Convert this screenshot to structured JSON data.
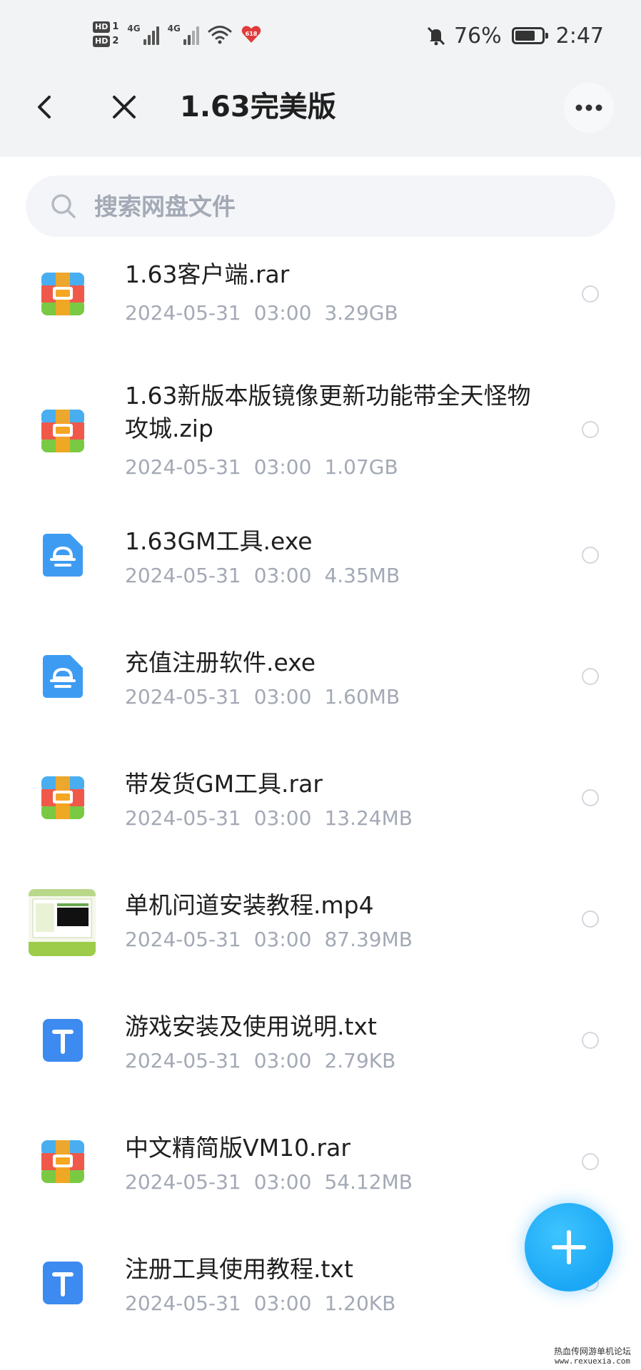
{
  "status_bar": {
    "hd1": "HD",
    "hd1_sim": "1",
    "hd2": "HD",
    "hd2_sim": "2",
    "net1": "4G",
    "net2": "4G",
    "heart_badge": "618",
    "battery_percent": "76%",
    "battery_level": 0.76,
    "time": "2:47"
  },
  "header": {
    "title": "1.63完美版"
  },
  "search": {
    "placeholder": "搜索网盘文件"
  },
  "files": [
    {
      "name": "1.63客户端.rar",
      "date": "2024-05-31",
      "time": "03:00",
      "size": "3.29GB",
      "icon": "archive-icon"
    },
    {
      "name": "1.63新版本版镜像更新功能带全天怪物攻城.zip",
      "date": "2024-05-31",
      "time": "03:00",
      "size": "1.07GB",
      "icon": "archive-icon"
    },
    {
      "name": "1.63GM工具.exe",
      "date": "2024-05-31",
      "time": "03:00",
      "size": "4.35MB",
      "icon": "executable-icon"
    },
    {
      "name": "充值注册软件.exe",
      "date": "2024-05-31",
      "time": "03:00",
      "size": "1.60MB",
      "icon": "executable-icon"
    },
    {
      "name": "带发货GM工具.rar",
      "date": "2024-05-31",
      "time": "03:00",
      "size": "13.24MB",
      "icon": "archive-icon"
    },
    {
      "name": "单机问道安装教程.mp4",
      "date": "2024-05-31",
      "time": "03:00",
      "size": "87.39MB",
      "icon": "video-thumbnail"
    },
    {
      "name": "游戏安装及使用说明.txt",
      "date": "2024-05-31",
      "time": "03:00",
      "size": "2.79KB",
      "icon": "text-file-icon"
    },
    {
      "name": "中文精简版VM10.rar",
      "date": "2024-05-31",
      "time": "03:00",
      "size": "54.12MB",
      "icon": "archive-icon"
    },
    {
      "name": "注册工具使用教程.txt",
      "date": "2024-05-31",
      "time": "03:00",
      "size": "1.20KB",
      "icon": "text-file-icon"
    }
  ],
  "watermark": {
    "line1": "热血传网游单机论坛",
    "line2": "www.rexuexia.com"
  },
  "colors": {
    "header_bg": "#f2f3f5",
    "meta_text": "#a3a9b5",
    "fab": "#1ba7f5",
    "archive_top": "#49aef0",
    "archive_mid": "#f0594a",
    "archive_bottom": "#7ac943",
    "archive_clasp": "#f5a623",
    "exe_blue": "#3d9cf2",
    "txt_blue": "#3d8af0"
  }
}
